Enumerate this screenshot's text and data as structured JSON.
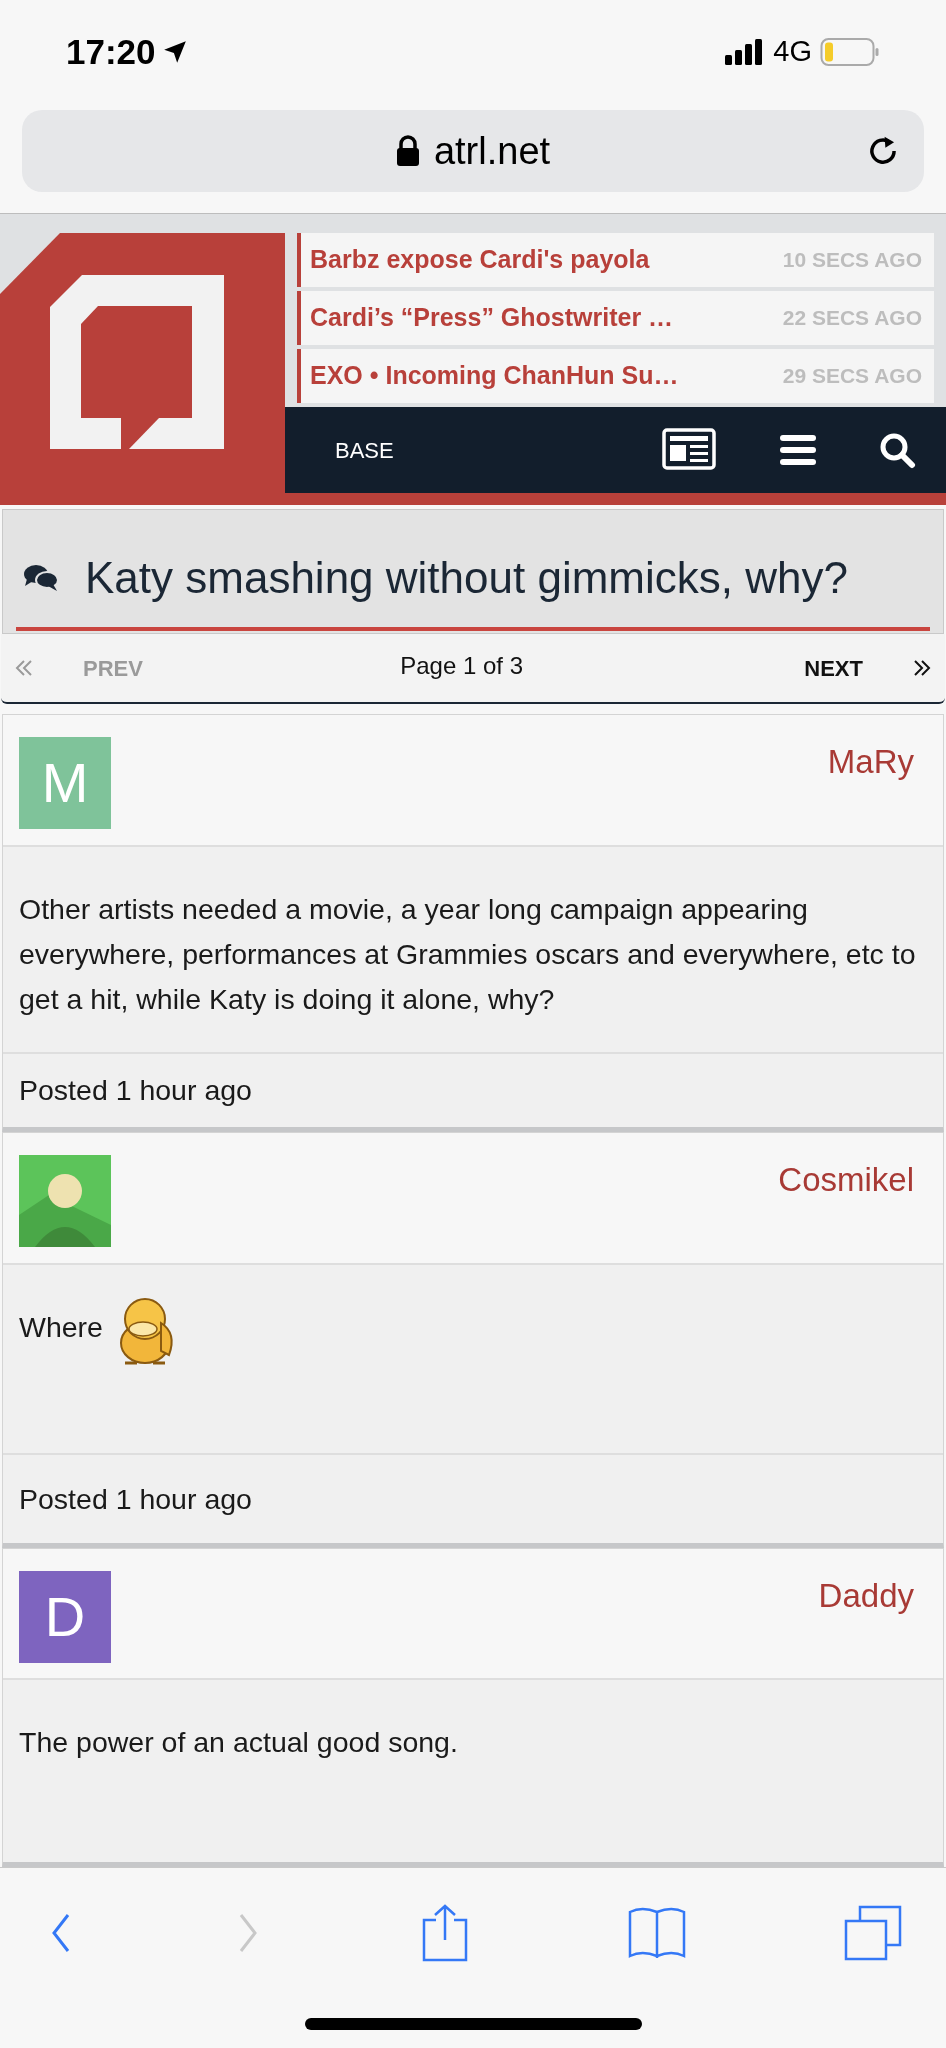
{
  "status_bar": {
    "time": "17:20",
    "network": "4G"
  },
  "browser": {
    "url": "atrl.net"
  },
  "ticker": [
    {
      "headline": "Barbz expose Cardi's payola",
      "time": "10 SECS AGO"
    },
    {
      "headline": "Cardi’s “Press” Ghostwriter …",
      "time": "22 SECS AGO"
    },
    {
      "headline": "EXO • Incoming ChanHun Su…",
      "time": "29 SECS AGO"
    }
  ],
  "nav": {
    "label": "BASE"
  },
  "thread": {
    "title": "Katy smashing without gimmicks, why?"
  },
  "pager": {
    "prev": {
      "label": "PREV",
      "disabled": true
    },
    "page": "Page 1 of 3",
    "next": {
      "label": "NEXT",
      "disabled": false
    }
  },
  "posts": [
    {
      "avatar": {
        "kind": "letter",
        "letter": "M",
        "color": "#7fc39a"
      },
      "username": "MaRy",
      "body": "Other artists needed a movie, a year long campaign appearing everywhere, performances at Grammies oscars and everywhere, etc to get a hit, while Katy is doing it alone, why?",
      "posted": "Posted 1 hour ago"
    },
    {
      "username": "Cosmikel",
      "body": "Where",
      "sticker": true,
      "posted": "Posted 1 hour ago"
    },
    {
      "avatar": {
        "kind": "letter",
        "letter": "D",
        "color": "#7e64bf"
      },
      "username": "Daddy",
      "body": "The power of an actual good song."
    }
  ],
  "toolbar": [
    {
      "kind": "back",
      "disabled": false
    },
    {
      "kind": "forward",
      "disabled": true
    },
    {
      "kind": "share",
      "disabled": false
    },
    {
      "kind": "bookmarks",
      "disabled": false
    },
    {
      "kind": "tabs",
      "disabled": false
    }
  ]
}
